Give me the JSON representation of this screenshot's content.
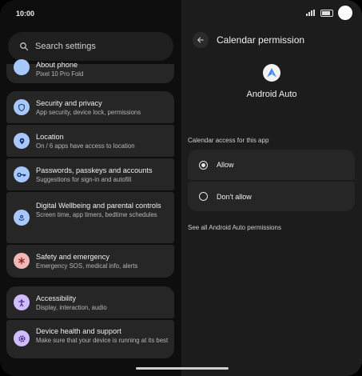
{
  "status": {
    "time": "10:00"
  },
  "search": {
    "placeholder": "Search settings"
  },
  "settings_list": [
    {
      "title": "About phone",
      "subtitle": "Pixel 10 Pro Fold",
      "icon": "phone-icon"
    },
    {
      "title": "Security and privacy",
      "subtitle": "App security, device lock, permissions",
      "icon": "shield-icon"
    },
    {
      "title": "Location",
      "subtitle": "On / 6 apps have access to location",
      "icon": "location-pin-icon"
    },
    {
      "title": "Passwords, passkeys and accounts",
      "subtitle": "Suggestions for sign-in and autofill",
      "icon": "key-icon"
    },
    {
      "title": "Digital Wellbeing and parental controls",
      "subtitle": "Screen time, app timers, bedtime schedules",
      "icon": "wellbeing-icon"
    },
    {
      "title": "Safety and emergency",
      "subtitle": "Emergency SOS, medical info, alerts",
      "icon": "asterisk-icon"
    },
    {
      "title": "Accessibility",
      "subtitle": "Display, interaction, audio",
      "icon": "accessibility-icon"
    },
    {
      "title": "Device health and support",
      "subtitle": "Make sure that your device is running at its best",
      "icon": "gear-icon"
    }
  ],
  "detail": {
    "title": "Calendar permission",
    "app_name": "Android Auto",
    "section_label": "Calendar access for this app",
    "options": [
      {
        "label": "Allow",
        "selected": true
      },
      {
        "label": "Don't allow",
        "selected": false
      }
    ],
    "see_all": "See all Android Auto permissions"
  },
  "colors": {
    "icon_blue": "#a8c7fa",
    "icon_pink": "#f2b8b5",
    "icon_purple": "#d0bcff",
    "android_auto_blue": "#4285f4"
  }
}
